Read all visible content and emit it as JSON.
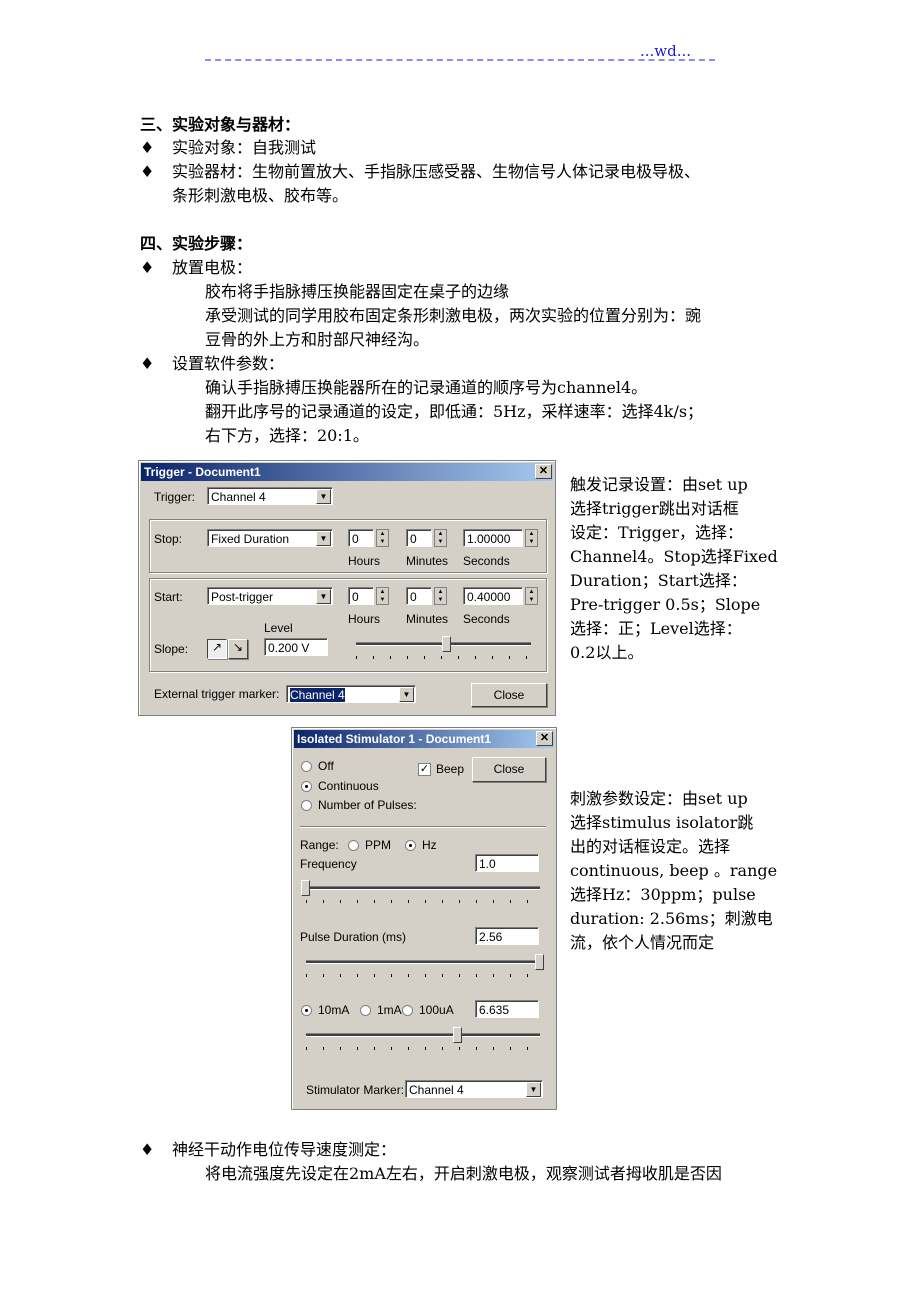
{
  "header": {
    "mark": "...wd..."
  },
  "sections": {
    "s3_title": "三、实验对象与器材：",
    "s3_items": [
      "实验对象：自我测试",
      "实验器材：生物前置放大、手指脉压感受器、生物信号人体记录电极导极、",
      "条形刺激电极、胶布等。"
    ],
    "s4_title": "四、实验步骤：",
    "step1": "放置电极：",
    "step1_lines": [
      "胶布将手指脉搏压换能器固定在桌子的边缘",
      "承受测试的同学用胶布固定条形刺激电极，两次实验的位置分别为：豌",
      "豆骨的外上方和肘部尺神经沟。"
    ],
    "step2": "设置软件参数：",
    "step2_lines": [
      "确认手指脉搏压换能器所在的记录通道的顺序号为channel4。",
      "翻开此序号的记录通道的设定，即低通：5Hz，采样速率：选择4k/s；",
      "右下方，选择：20:1。"
    ],
    "trigger_note": [
      "触发记录设置：由set up",
      "选择trigger跳出对话框",
      "设定：Trigger，选择：",
      "Channel4。Stop选择Fixed",
      "Duration；Start选择：",
      "Pre-trigger 0.5s；Slope",
      "选择：正；Level选择：",
      "0.2以上。"
    ],
    "stim_note": [
      "刺激参数设定：由set up",
      "选择stimulus isolator跳",
      "出的对话框设定。选择",
      "continuous, beep 。range",
      "选择Hz：30ppm；pulse",
      "duration: 2.56ms；刺激电",
      "流，依个人情况而定"
    ],
    "step3": "神经干动作电位传导速度测定：",
    "step3_lines": [
      "将电流强度先设定在2mA左右，开启刺激电极，观察测试者拇收肌是否因"
    ],
    "bullet": "♦"
  },
  "trigger_dialog": {
    "title": "Trigger - Document1",
    "close_x": "✕",
    "trigger_label": "Trigger:",
    "trigger_value": "Channel 4",
    "stop_label": "Stop:",
    "stop_value": "Fixed Duration",
    "stop_hours": "0",
    "stop_minutes": "0",
    "stop_seconds": "1.00000",
    "start_label": "Start:",
    "start_value": "Post-trigger",
    "start_hours": "0",
    "start_minutes": "0",
    "start_seconds": "0.40000",
    "hours": "Hours",
    "minutes": "Minutes",
    "seconds": "Seconds",
    "level_label": "Level",
    "level_value": "0.200 V",
    "slope_label": "Slope:",
    "slope_rise": "↗",
    "slope_fall": "↘",
    "level_slider_fraction": 0.52,
    "ext_label": "External trigger marker:",
    "ext_value": "Channel 4",
    "close": "Close"
  },
  "stim_dialog": {
    "title": "Isolated Stimulator 1 - Document1",
    "close_x": "✕",
    "off": "Off",
    "continuous": "Continuous",
    "pulses": "Number of Pulses:",
    "mode_selected": "Continuous",
    "beep": "Beep",
    "beep_checked": true,
    "close": "Close",
    "range_label": "Range:",
    "ppm": "PPM",
    "hz": "Hz",
    "range_selected": "Hz",
    "frequency_label": "Frequency",
    "frequency_value": "1.0",
    "frequency_fraction": 0.0,
    "pulse_label": "Pulse Duration (ms)",
    "pulse_value": "2.56",
    "pulse_fraction": 1.0,
    "ma10": "10mA",
    "ma1": "1mA",
    "ua100": "100uA",
    "current_selected": "10mA",
    "current_value": "6.635",
    "current_fraction": 0.65,
    "marker_label": "Stimulator Marker:",
    "marker_value": "Channel 4"
  }
}
